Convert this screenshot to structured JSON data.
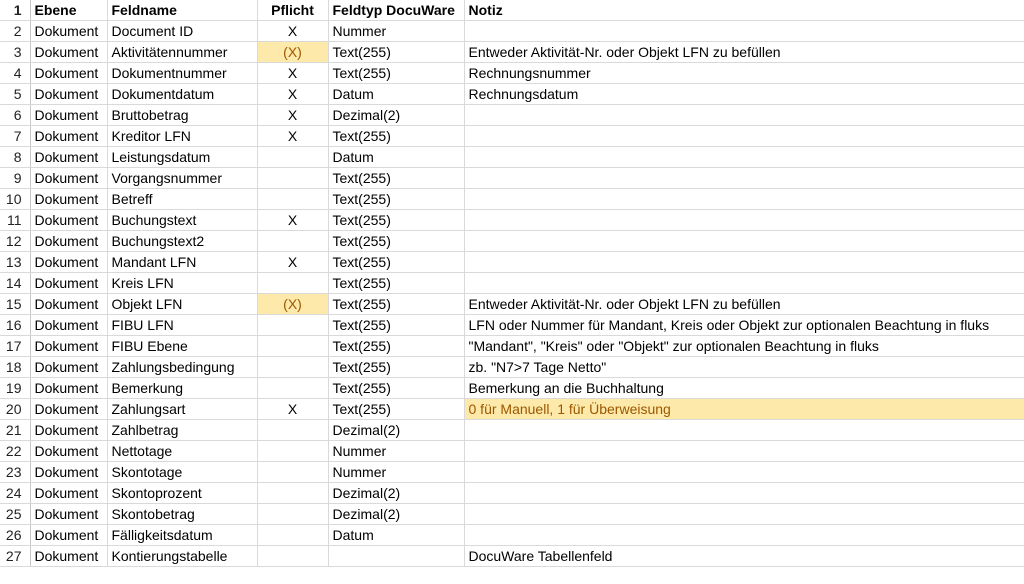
{
  "header": {
    "row_number": "1",
    "ebene": "Ebene",
    "feldname": "Feldname",
    "pflicht": "Pflicht",
    "feldtyp": "Feldtyp DocuWare",
    "notiz": "Notiz"
  },
  "highlight_color": "#fde9a9",
  "highlight_text_color": "#9c5700",
  "rows": [
    {
      "n": "2",
      "ebene": "Dokument",
      "feldname": "Document ID",
      "pflicht": "X",
      "feldtyp": "Nummer",
      "notiz": ""
    },
    {
      "n": "3",
      "ebene": "Dokument",
      "feldname": "Aktivitätennummer",
      "pflicht": "(X)",
      "feldtyp": "Text(255)",
      "notiz": "Entweder Aktivität-Nr. oder Objekt LFN zu befüllen"
    },
    {
      "n": "4",
      "ebene": "Dokument",
      "feldname": "Dokumentnummer",
      "pflicht": "X",
      "feldtyp": "Text(255)",
      "notiz": "Rechnungsnummer"
    },
    {
      "n": "5",
      "ebene": "Dokument",
      "feldname": "Dokumentdatum",
      "pflicht": "X",
      "feldtyp": "Datum",
      "notiz": "Rechnungsdatum"
    },
    {
      "n": "6",
      "ebene": "Dokument",
      "feldname": "Bruttobetrag",
      "pflicht": "X",
      "feldtyp": "Dezimal(2)",
      "notiz": ""
    },
    {
      "n": "7",
      "ebene": "Dokument",
      "feldname": "Kreditor LFN",
      "pflicht": "X",
      "feldtyp": "Text(255)",
      "notiz": ""
    },
    {
      "n": "8",
      "ebene": "Dokument",
      "feldname": "Leistungsdatum",
      "pflicht": "",
      "feldtyp": "Datum",
      "notiz": ""
    },
    {
      "n": "9",
      "ebene": "Dokument",
      "feldname": "Vorgangsnummer",
      "pflicht": "",
      "feldtyp": "Text(255)",
      "notiz": ""
    },
    {
      "n": "10",
      "ebene": "Dokument",
      "feldname": "Betreff",
      "pflicht": "",
      "feldtyp": "Text(255)",
      "notiz": ""
    },
    {
      "n": "11",
      "ebene": "Dokument",
      "feldname": "Buchungstext",
      "pflicht": "X",
      "feldtyp": "Text(255)",
      "notiz": ""
    },
    {
      "n": "12",
      "ebene": "Dokument",
      "feldname": "Buchungstext2",
      "pflicht": "",
      "feldtyp": "Text(255)",
      "notiz": ""
    },
    {
      "n": "13",
      "ebene": "Dokument",
      "feldname": "Mandant LFN",
      "pflicht": "X",
      "feldtyp": "Text(255)",
      "notiz": ""
    },
    {
      "n": "14",
      "ebene": "Dokument",
      "feldname": "Kreis LFN",
      "pflicht": "",
      "feldtyp": "Text(255)",
      "notiz": ""
    },
    {
      "n": "15",
      "ebene": "Dokument",
      "feldname": "Objekt LFN",
      "pflicht": "(X)",
      "feldtyp": "Text(255)",
      "notiz": "Entweder Aktivität-Nr. oder Objekt LFN zu befüllen"
    },
    {
      "n": "16",
      "ebene": "Dokument",
      "feldname": "FIBU LFN",
      "pflicht": "",
      "feldtyp": "Text(255)",
      "notiz": "LFN oder Nummer für Mandant, Kreis oder Objekt zur optionalen Beachtung in fluks"
    },
    {
      "n": "17",
      "ebene": "Dokument",
      "feldname": "FIBU Ebene",
      "pflicht": "",
      "feldtyp": "Text(255)",
      "notiz": "\"Mandant\", \"Kreis\" oder \"Objekt\" zur optionalen Beachtung in fluks"
    },
    {
      "n": "18",
      "ebene": "Dokument",
      "feldname": "Zahlungsbedingung",
      "pflicht": "",
      "feldtyp": "Text(255)",
      "notiz": "zb. \"N7>7 Tage Netto\""
    },
    {
      "n": "19",
      "ebene": "Dokument",
      "feldname": "Bemerkung",
      "pflicht": "",
      "feldtyp": "Text(255)",
      "notiz": "Bemerkung an die Buchhaltung"
    },
    {
      "n": "20",
      "ebene": "Dokument",
      "feldname": "Zahlungsart",
      "pflicht": "X",
      "feldtyp": "Text(255)",
      "notiz": "0 für Manuell, 1 für Überweisung"
    },
    {
      "n": "21",
      "ebene": "Dokument",
      "feldname": "Zahlbetrag",
      "pflicht": "",
      "feldtyp": "Dezimal(2)",
      "notiz": ""
    },
    {
      "n": "22",
      "ebene": "Dokument",
      "feldname": "Nettotage",
      "pflicht": "",
      "feldtyp": "Nummer",
      "notiz": ""
    },
    {
      "n": "23",
      "ebene": "Dokument",
      "feldname": "Skontotage",
      "pflicht": "",
      "feldtyp": "Nummer",
      "notiz": ""
    },
    {
      "n": "24",
      "ebene": "Dokument",
      "feldname": "Skontoprozent",
      "pflicht": "",
      "feldtyp": "Dezimal(2)",
      "notiz": ""
    },
    {
      "n": "25",
      "ebene": "Dokument",
      "feldname": "Skontobetrag",
      "pflicht": "",
      "feldtyp": "Dezimal(2)",
      "notiz": ""
    },
    {
      "n": "26",
      "ebene": "Dokument",
      "feldname": "Fälligkeitsdatum",
      "pflicht": "",
      "feldtyp": "Datum",
      "notiz": ""
    },
    {
      "n": "27",
      "ebene": "Dokument",
      "feldname": "Kontierungstabelle",
      "pflicht": "",
      "feldtyp": "",
      "notiz": "DocuWare Tabellenfeld"
    }
  ]
}
